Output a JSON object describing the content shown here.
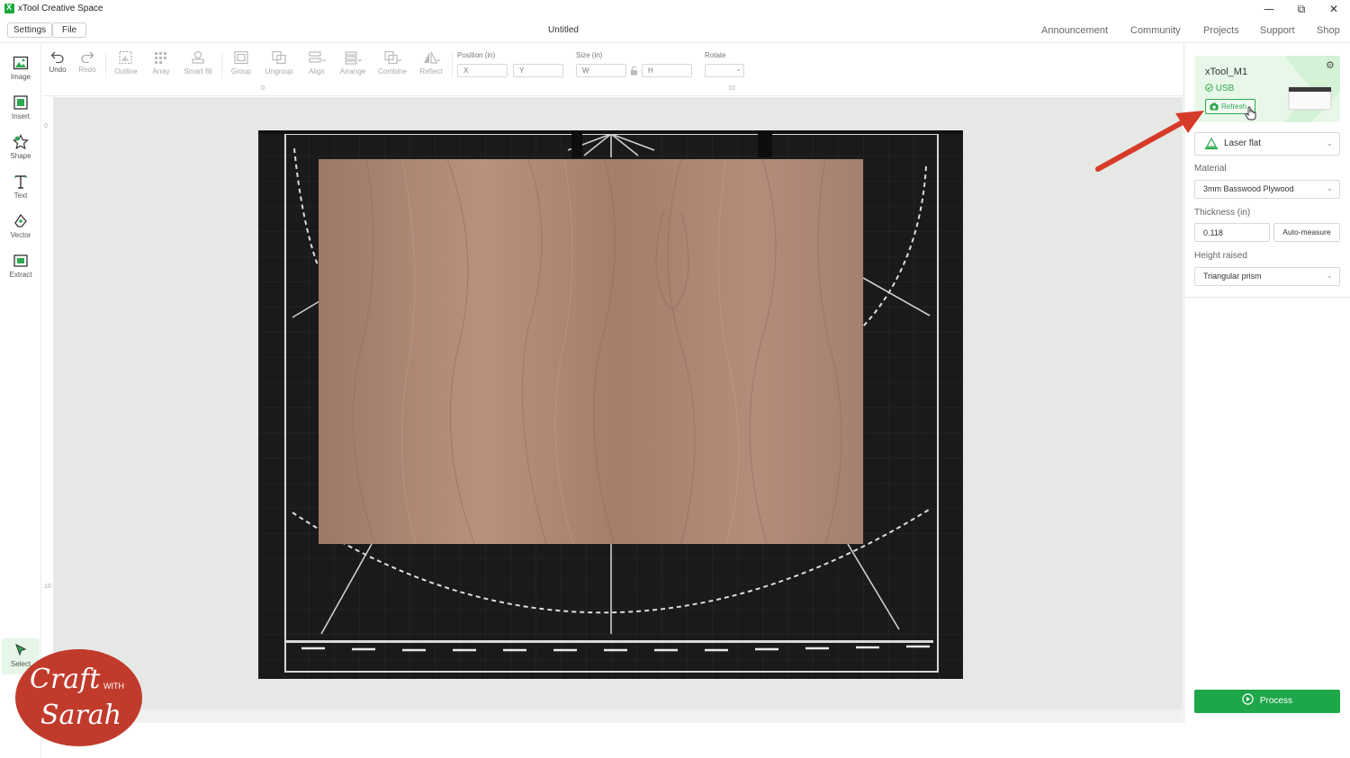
{
  "window": {
    "title": "xTool Creative Space",
    "controls": {
      "minimize": "—",
      "maximize": "⧉",
      "close": "✕"
    }
  },
  "menubar": {
    "settings_label": "Settings",
    "file_label": "File",
    "document_title": "Untitled",
    "nav": [
      "Announcement",
      "Community",
      "Projects",
      "Support",
      "Shop"
    ]
  },
  "left_tools": [
    {
      "label": "Image",
      "icon": "image-icon"
    },
    {
      "label": "Insert",
      "icon": "insert-icon"
    },
    {
      "label": "Shape",
      "icon": "shape-icon"
    },
    {
      "label": "Text",
      "icon": "text-icon"
    },
    {
      "label": "Vector",
      "icon": "vector-pen-icon"
    },
    {
      "label": "Extract",
      "icon": "extract-icon"
    }
  ],
  "left_bottom_tools": [
    {
      "label": "Select",
      "icon": "select-cursor-icon",
      "active": true
    }
  ],
  "toolbar": {
    "buttons": [
      {
        "label": "Undo",
        "icon": "undo-icon",
        "enabled": true
      },
      {
        "label": "Redo",
        "icon": "redo-icon",
        "enabled": false
      },
      {
        "label": "Outline",
        "icon": "outline-icon",
        "enabled": false
      },
      {
        "label": "Array",
        "icon": "array-icon",
        "enabled": false
      },
      {
        "label": "Smart fill",
        "icon": "smart-fill-icon",
        "enabled": false
      },
      {
        "label": "Group",
        "icon": "group-icon",
        "enabled": false
      },
      {
        "label": "Ungroup",
        "icon": "ungroup-icon",
        "enabled": false
      },
      {
        "label": "Align",
        "icon": "align-icon",
        "enabled": false
      },
      {
        "label": "Arrange",
        "icon": "arrange-icon",
        "enabled": false
      },
      {
        "label": "Combine",
        "icon": "combine-icon",
        "enabled": false
      },
      {
        "label": "Reflect",
        "icon": "reflect-icon",
        "enabled": false
      }
    ],
    "position_label": "Position (in)",
    "x_placeholder": "X",
    "y_placeholder": "Y",
    "size_label": "Size (in)",
    "w_placeholder": "W",
    "h_placeholder": "H",
    "rotate_label": "Rotate",
    "rotate_value": ""
  },
  "rulers": {
    "top_ticks": [
      "0",
      "10"
    ],
    "left_ticks": [
      "0",
      "10"
    ]
  },
  "right_panel": {
    "device_name": "xTool_M1",
    "connection": "USB",
    "refresh_label": "Refresh",
    "mode": "Laser flat",
    "material_label": "Material",
    "material_value": "3mm Basswood Plywood",
    "thickness_label": "Thickness (in)",
    "thickness_value": "0.118",
    "auto_measure_label": "Auto-measure",
    "height_raised_label": "Height raised",
    "height_raised_value": "Triangular prism",
    "process_label": "Process"
  },
  "overlay_logo": {
    "line1": "Craft",
    "with": "WITH",
    "line2": "Sarah"
  },
  "colors": {
    "accent_green": "#1ea64a",
    "annotation_red": "#d63b2a",
    "logo_red": "#c13b2d",
    "canvas_bg": "#e6e8e6"
  }
}
